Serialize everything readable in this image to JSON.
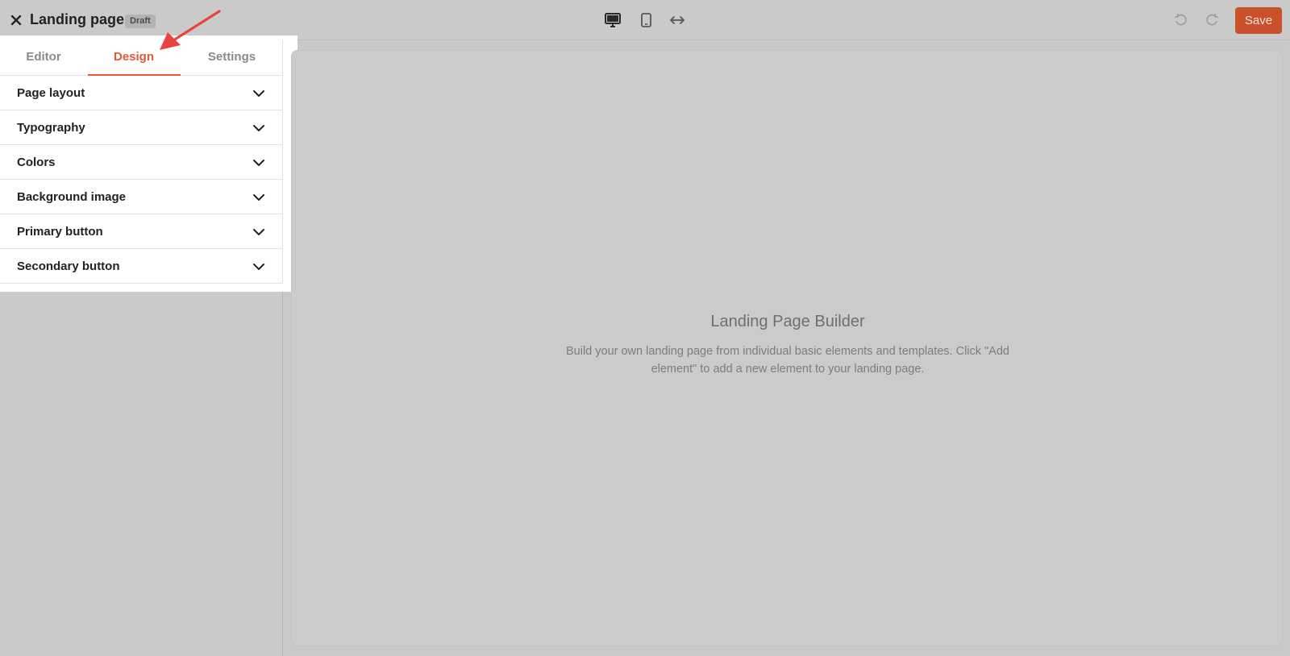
{
  "header": {
    "title": "Landing page",
    "badge": "Draft",
    "save_label": "Save",
    "icons": {
      "close": "close-icon",
      "desktop": "desktop-icon",
      "mobile": "mobile-icon",
      "full_width": "arrows-horizontal-icon",
      "undo": "undo-icon",
      "redo": "redo-icon"
    }
  },
  "tabs": [
    {
      "label": "Editor",
      "active": false
    },
    {
      "label": "Design",
      "active": true
    },
    {
      "label": "Settings",
      "active": false
    }
  ],
  "design_sections": [
    {
      "label": "Page layout"
    },
    {
      "label": "Typography"
    },
    {
      "label": "Colors"
    },
    {
      "label": "Background image"
    },
    {
      "label": "Primary button"
    },
    {
      "label": "Secondary button"
    }
  ],
  "canvas": {
    "title": "Landing Page Builder",
    "description": "Build your own landing page from individual basic elements and templates. Click \"Add element\" to add a new element to your landing page."
  },
  "colors": {
    "accent": "#e2583a",
    "save_button": "#c9512b",
    "annotation_arrow": "#e8433f"
  }
}
